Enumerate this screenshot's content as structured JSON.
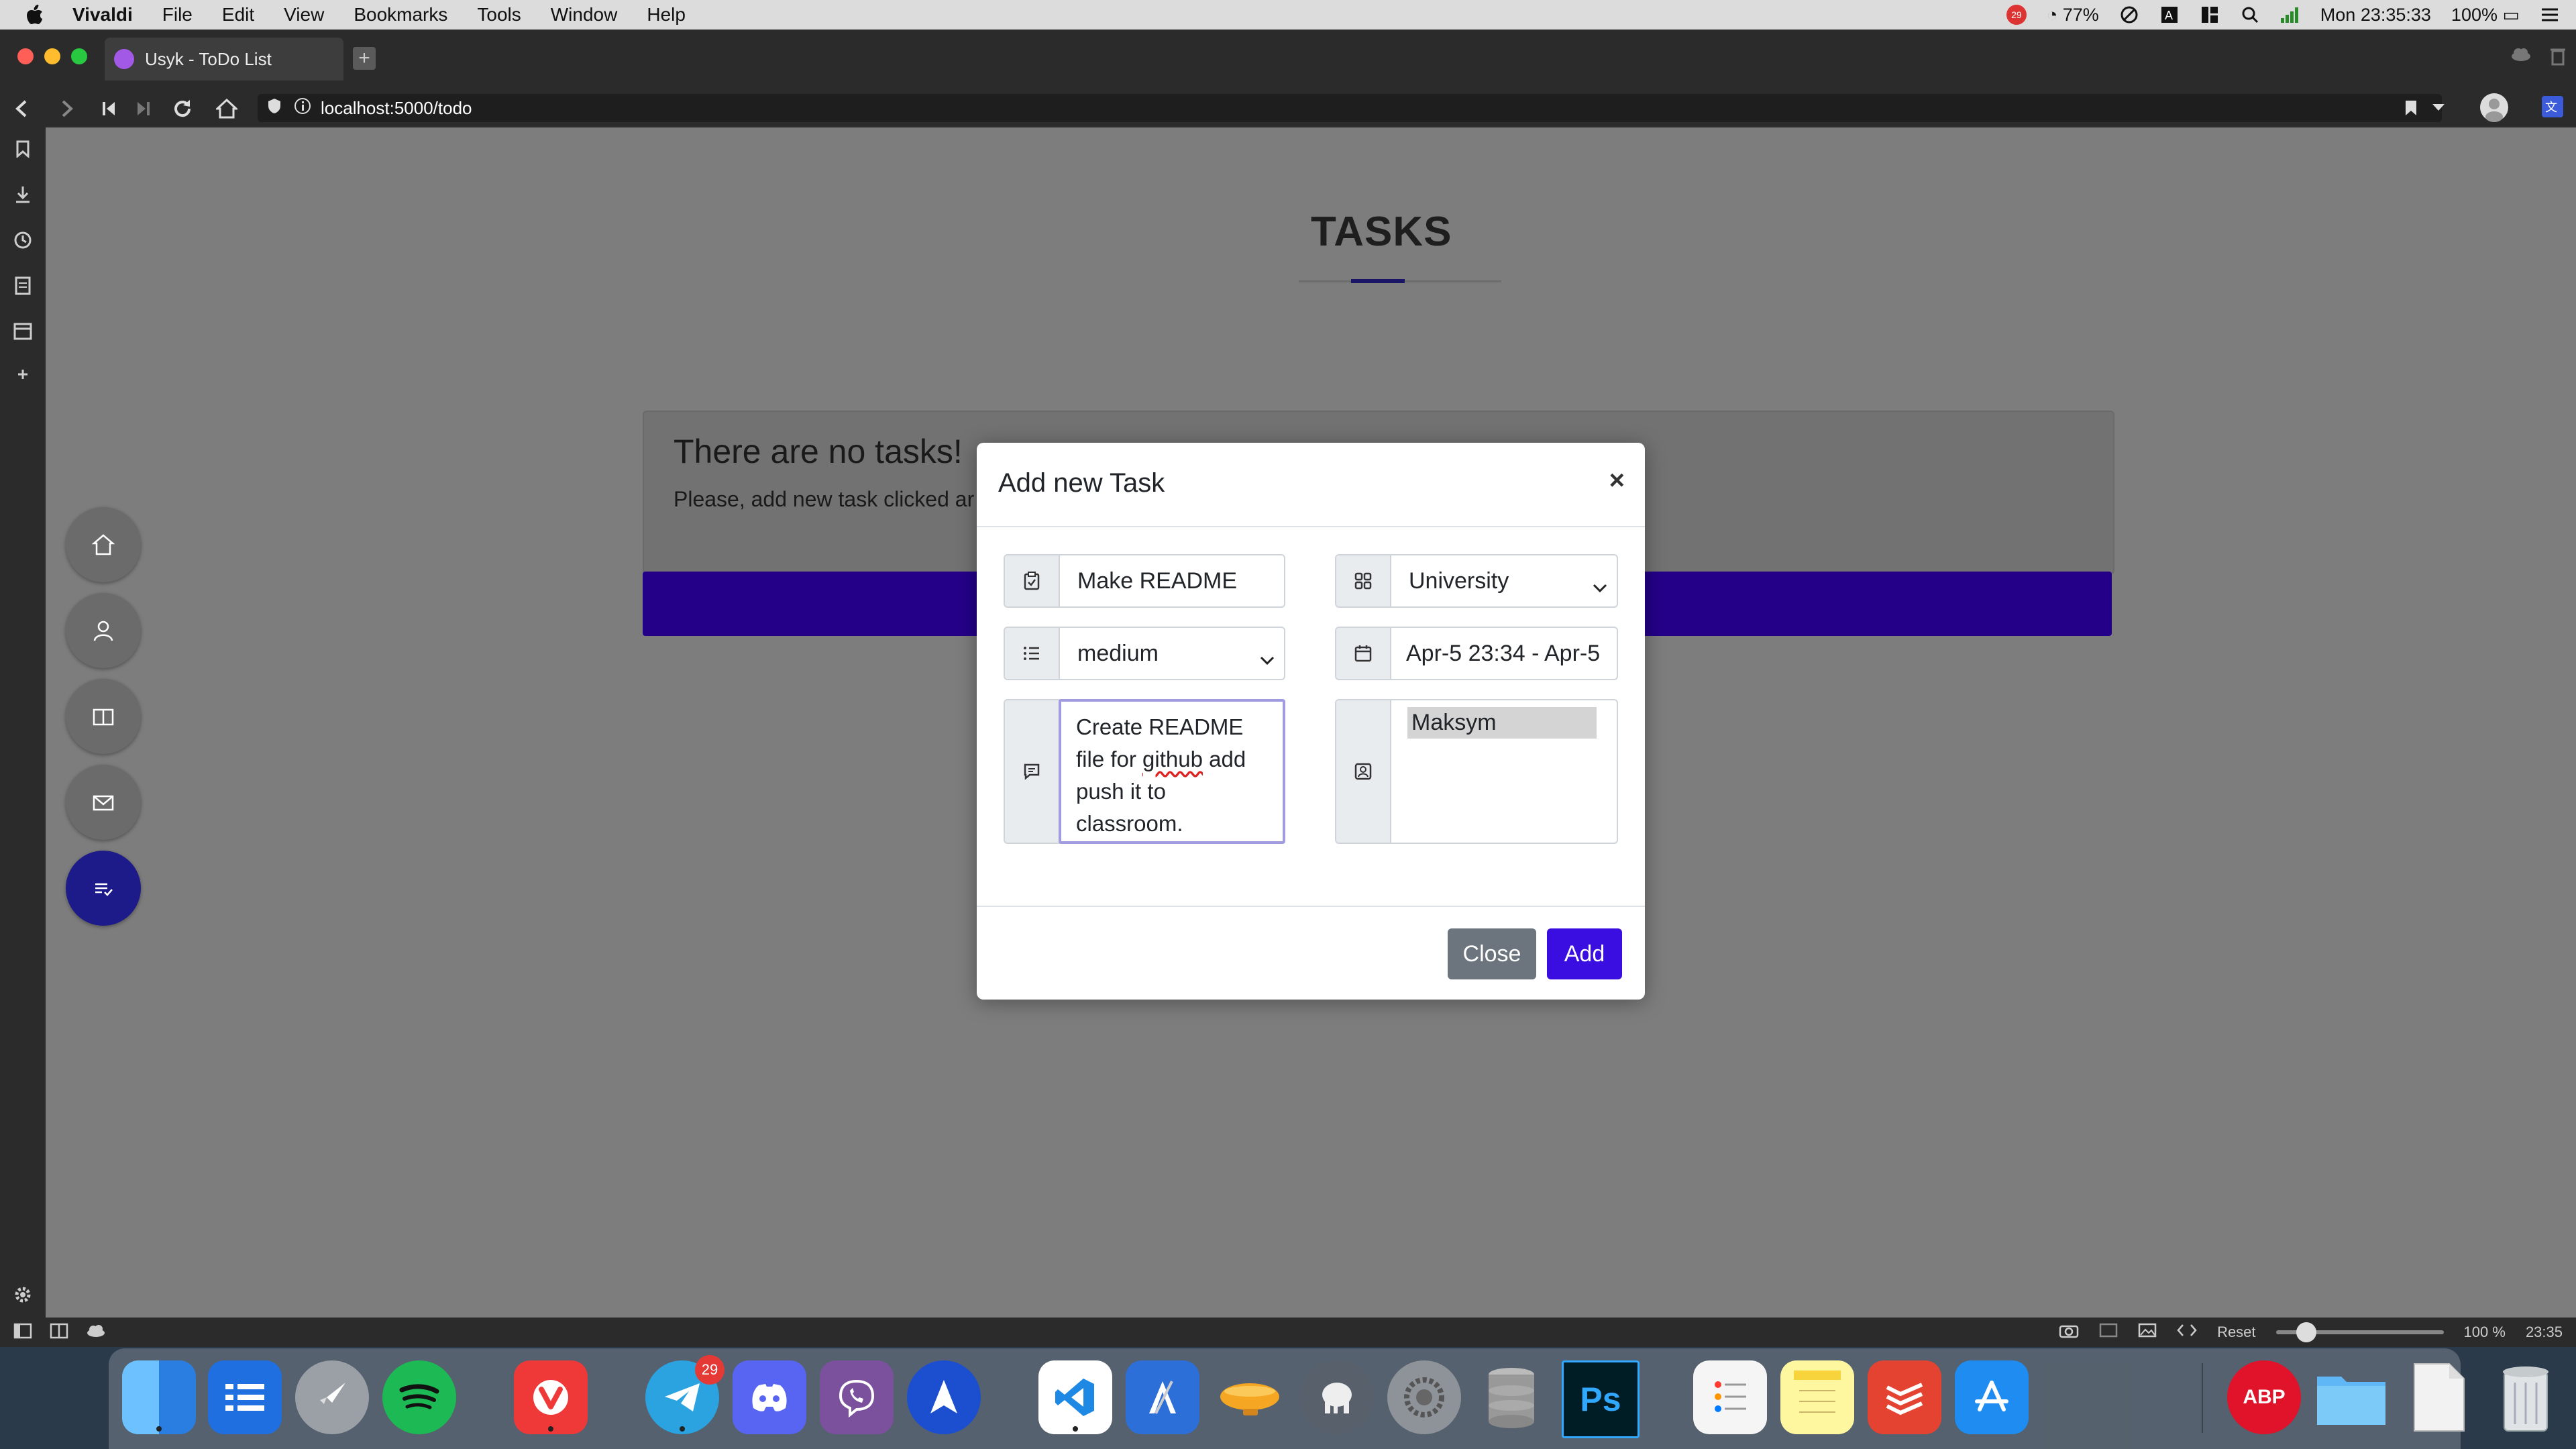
{
  "menubar": {
    "app_name": "Vivaldi",
    "items": [
      "File",
      "Edit",
      "View",
      "Bookmarks",
      "Tools",
      "Window",
      "Help"
    ],
    "status": {
      "battery_small": "77%",
      "clock": "Mon 23:35:33",
      "battery": "100%",
      "notification_count": "29"
    }
  },
  "browser": {
    "tab_title": "Usyk - ToDo List",
    "url": "localhost:5000/todo"
  },
  "page": {
    "heading": "TASKS",
    "empty_title": "There are no tasks!",
    "empty_text": "Please, add new task clicked ar"
  },
  "modal": {
    "title": "Add new Task",
    "close_glyph": "×",
    "name_value": "Make README",
    "category_value": "University",
    "priority_value": "medium",
    "date_value": "Apr-5 23:34 - Apr-5",
    "description_line1": "Create README",
    "description_line2_a": "file for ",
    "description_line2_b": "github",
    "description_line2_c": " add",
    "description_line3": "push it to",
    "description_line4": "classroom.",
    "assignee_selected": "Maksym",
    "close_label": "Close",
    "add_label": "Add"
  },
  "statusbar": {
    "reset_label": "Reset",
    "zoom": "100 %",
    "time": "23:35"
  },
  "dock": {
    "telegram_badge": "29",
    "photoshop_label": "Ps",
    "abp_label": "ABP"
  },
  "colors": {
    "accent_purple": "#3a0ee0",
    "page_bar": "#240088",
    "active_fab": "#1d1a8a"
  }
}
